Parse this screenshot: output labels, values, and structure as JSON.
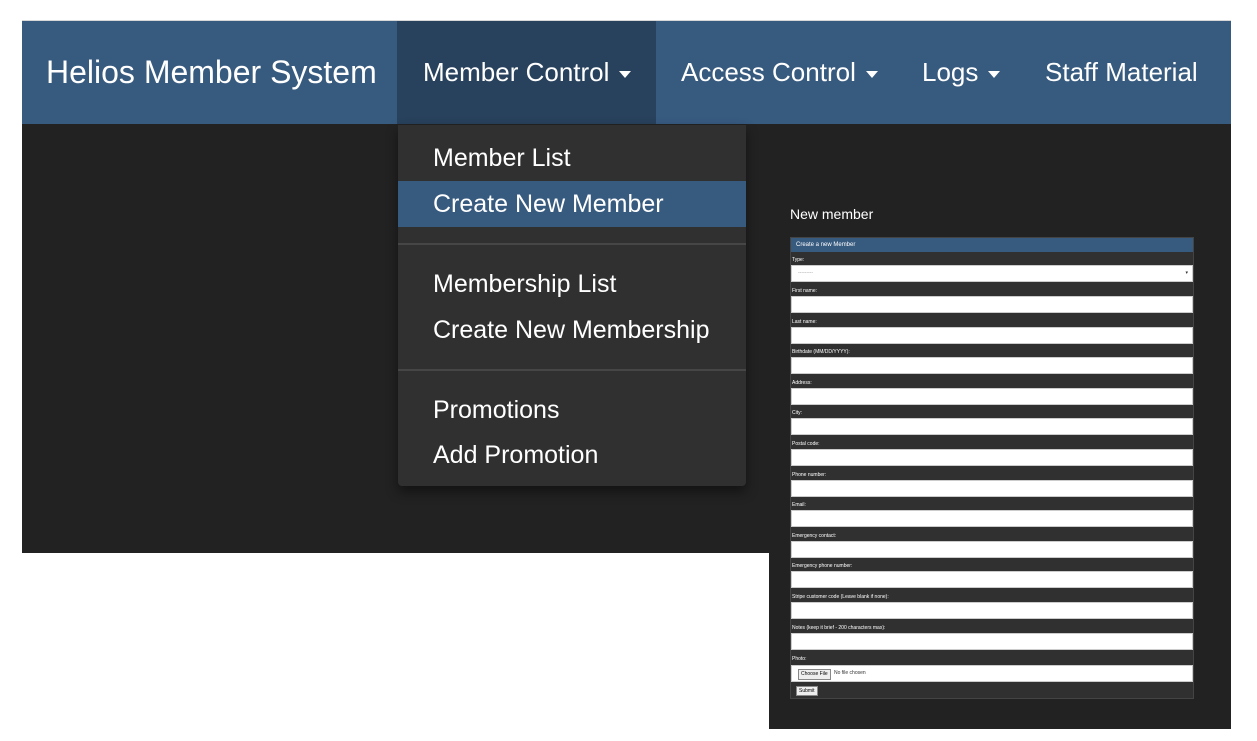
{
  "navbar": {
    "brand": "Helios Member System",
    "items": [
      {
        "label": "Member Control"
      },
      {
        "label": "Access Control"
      },
      {
        "label": "Logs"
      },
      {
        "label": "Staff Material"
      }
    ]
  },
  "dropdown": {
    "items": [
      {
        "label": "Member List"
      },
      {
        "label": "Create New Member"
      },
      {
        "label": "Membership List"
      },
      {
        "label": "Create New Membership"
      },
      {
        "label": "Promotions"
      },
      {
        "label": "Add Promotion"
      }
    ],
    "active": "Create New Member"
  },
  "form": {
    "page_title": "New member",
    "card_header": "Create a new Member",
    "type_label": "Type:",
    "type_value": "---------",
    "labels": [
      "First name:",
      "Last name:",
      "Birthdate (MM/DD/YYYY):",
      "Address:",
      "City:",
      "Postal code:",
      "Phone number:",
      "Email:",
      "Emergency contact:",
      "Emergency phone number:",
      "Stripe customer code (Leave blank if none):",
      "Notes (keep it brief - 200 characters max):"
    ],
    "photo_label": "Photo:",
    "choose_file": "Choose File",
    "no_file": "No file chosen",
    "submit": "Submit"
  },
  "colors": {
    "navbar": "#375a7f",
    "navbar_active": "#28415c",
    "background": "#222222",
    "dropdown": "#303030",
    "dropdown_active": "#375a7f"
  }
}
